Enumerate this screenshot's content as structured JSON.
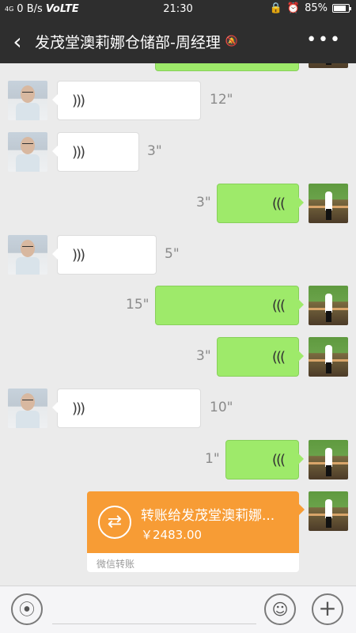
{
  "status_bar": {
    "signal": "4G",
    "net_speed": "0 B/s",
    "volte": "VoLTE",
    "time": "21:30",
    "alarm_icon": "alarm-icon",
    "lock_icon": "rotation-lock-icon",
    "battery_percent": "85%",
    "battery_level": 0.85
  },
  "header": {
    "back_icon": "chevron-left-icon",
    "title": "发茂堂澳莉娜仓储部-周经理",
    "mute_icon": "bell-muted-icon",
    "more_icon": "more-dots-icon"
  },
  "colors": {
    "header_bg": "#2e2e2e",
    "chat_bg": "#ebebeb",
    "out_bubble": "#9eea6a",
    "in_bubble": "#ffffff",
    "transfer": "#f79c35"
  },
  "messages": [
    {
      "direction": "in",
      "type": "voice",
      "duration": "12\""
    },
    {
      "direction": "in",
      "type": "voice",
      "duration": "3\""
    },
    {
      "direction": "out",
      "type": "voice",
      "duration": "3\""
    },
    {
      "direction": "in",
      "type": "voice",
      "duration": "5\""
    },
    {
      "direction": "out",
      "type": "voice",
      "duration": "15\""
    },
    {
      "direction": "out",
      "type": "voice",
      "duration": "3\""
    },
    {
      "direction": "in",
      "type": "voice",
      "duration": "10\""
    },
    {
      "direction": "out",
      "type": "voice",
      "duration": "1\""
    },
    {
      "direction": "out",
      "type": "transfer",
      "title": "转账给发茂堂澳莉娜...",
      "amount": "￥2483.00",
      "footer": "微信转账"
    }
  ],
  "input_bar": {
    "voice_icon": "voice-icon",
    "emoji_icon": "emoji-icon",
    "plus_icon": "plus-icon",
    "placeholder": ""
  }
}
